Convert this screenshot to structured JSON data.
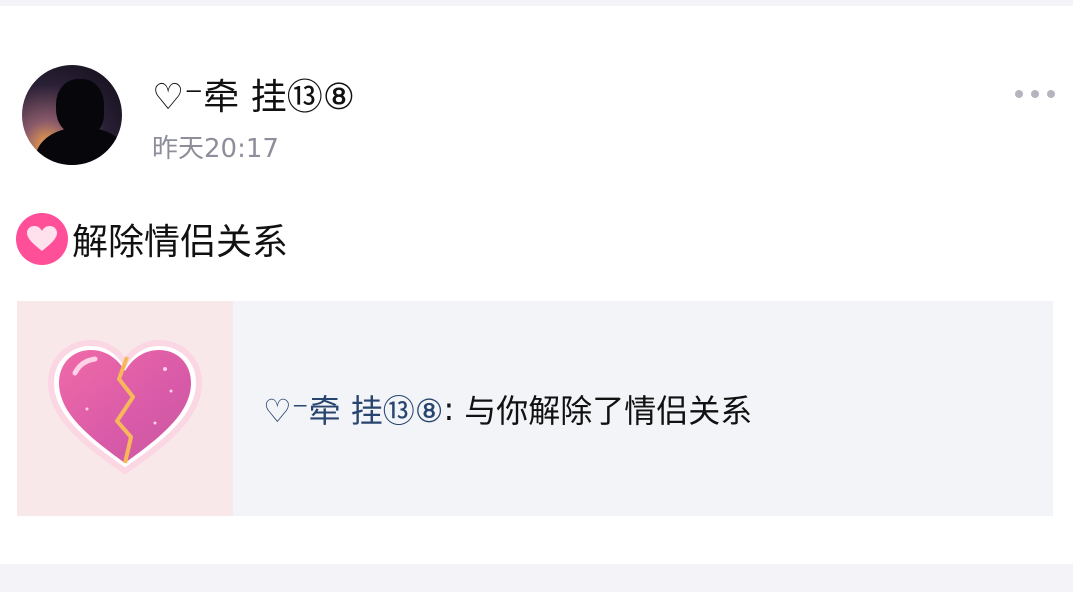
{
  "post": {
    "username": "♡⁻牵 挂⑬⑧",
    "timestamp": "昨天20:17",
    "content_text": "解除情侣关系"
  },
  "share_card": {
    "actor": "♡⁻牵 挂⑬⑧",
    "separator": ":",
    "action_text": "与你解除了情侣关系"
  },
  "colors": {
    "accent_pink": "#ff4f98",
    "link_blue": "#27456e",
    "timestamp_gray": "#8e8e9a"
  },
  "icons": {
    "more": "more-horizontal-icon",
    "emoji": "pink-heart-emoji-icon",
    "thumbnail": "broken-heart-icon"
  }
}
